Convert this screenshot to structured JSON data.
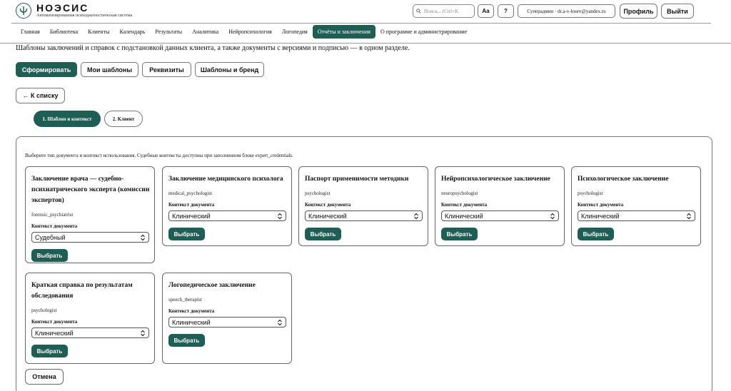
{
  "header": {
    "app_title": "НОЭСИС",
    "app_subtitle": "Автоматизированная психодиагностическая система",
    "search_placeholder": "Поиск... (Ctrl+K",
    "font_button": "Aa",
    "help_button": "?",
    "user_label": "Суперадмин · dr.a-v-losev@yandex.ru",
    "profile_button": "Профиль",
    "logout_button": "Выйти"
  },
  "nav": {
    "items": [
      {
        "label": "Главная"
      },
      {
        "label": "Библиотека"
      },
      {
        "label": "Клиенты"
      },
      {
        "label": "Календарь"
      },
      {
        "label": "Результаты"
      },
      {
        "label": "Аналитика"
      },
      {
        "label": "Нейропсихология"
      },
      {
        "label": "Логопедия"
      },
      {
        "label": "Отчёты и заключения"
      },
      {
        "label": "О программе и администрирование"
      }
    ],
    "active_index": 8
  },
  "intro_text": "Шаблоны заключений и справок с подстановкой данных клиента, а также документы с версиями и подписью — в одном разделе.",
  "toolbar": {
    "generate": "Сформировать",
    "my_templates": "Мои шаблоны",
    "requisites": "Реквизиты",
    "templates_brand": "Шаблоны и бренд"
  },
  "back_button": "← К списку",
  "steps": {
    "step1": "1. Шаблон и контекст",
    "step2": "2. Клиент"
  },
  "panel_description": "Выберите тип документа и контекст использования. Судебные контексты доступны при заполненном блоке expert_credentials.",
  "context_label": "Контекст документа",
  "select_button": "Выбрать",
  "cards": [
    {
      "title": "Заключение врача — судебно-психиатрического эксперта (комиссии экспертов)",
      "code": "forensic_psychiatrist",
      "context": "Судебный"
    },
    {
      "title": "Заключение медицинского психолога",
      "code": "medical_psychologist",
      "context": "Клинический"
    },
    {
      "title": "Паспорт применимости методики",
      "code": "psychologist",
      "context": "Клинический"
    },
    {
      "title": "Нейропсихологическое заключение",
      "code": "neuropsychologist",
      "context": "Клинический"
    },
    {
      "title": "Психологическое заключение",
      "code": "psychologist",
      "context": "Клинический"
    },
    {
      "title": "Краткая справка по результатам обследования",
      "code": "psychologist",
      "context": "Клинический"
    },
    {
      "title": "Логопедическое заключение",
      "code": "speech_therapist",
      "context": "Клинический"
    }
  ],
  "cancel_button": "Отмена",
  "colors": {
    "accent": "#1e5e55",
    "border": "#777777"
  }
}
